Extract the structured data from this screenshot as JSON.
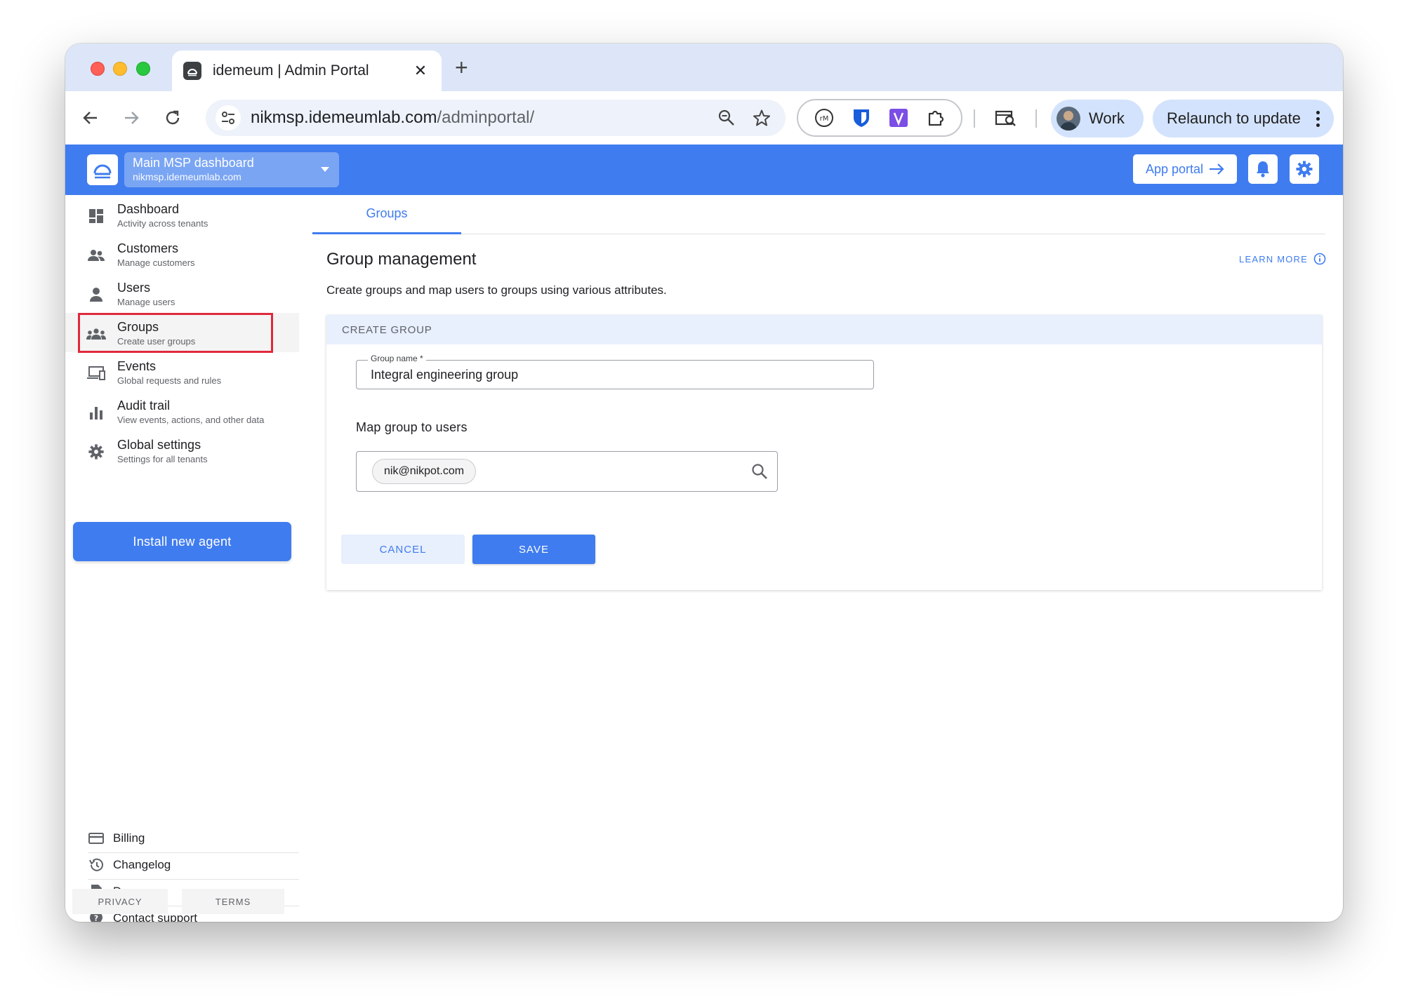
{
  "browser": {
    "tab_title": "idemeum | Admin Portal",
    "tab_close": "✕",
    "new_tab": "+",
    "url_host": "nikmsp.idemeumlab.com",
    "url_path": "/adminportal/",
    "profile_label": "Work",
    "relaunch_label": "Relaunch to update",
    "icons": [
      "back-icon",
      "forward-icon",
      "reload-icon",
      "tune-icon",
      "zoom-icon",
      "star-icon",
      "mymind-extension-icon",
      "bitwarden-extension-icon",
      "v-extension-icon",
      "extensions-puzzle-icon",
      "tab-search-icon"
    ]
  },
  "header": {
    "tenant_name": "Main MSP dashboard",
    "tenant_domain": "nikmsp.idemeumlab.com",
    "app_portal_label": "App portal",
    "brand_color": "#3f7cef"
  },
  "sidebar": {
    "items": [
      {
        "title": "Dashboard",
        "subtitle": "Activity across tenants",
        "icon": "dashboard-icon"
      },
      {
        "title": "Customers",
        "subtitle": "Manage customers",
        "icon": "customers-icon"
      },
      {
        "title": "Users",
        "subtitle": "Manage users",
        "icon": "user-icon"
      },
      {
        "title": "Groups",
        "subtitle": "Create user groups",
        "icon": "groups-icon",
        "active": true
      },
      {
        "title": "Events",
        "subtitle": "Global requests and rules",
        "icon": "devices-icon"
      },
      {
        "title": "Audit trail",
        "subtitle": "View events, actions, and other data",
        "icon": "bar-chart-icon"
      },
      {
        "title": "Global settings",
        "subtitle": "Settings for all tenants",
        "icon": "gear-icon"
      }
    ],
    "install_label": "Install new agent",
    "footer_links": [
      {
        "label": "Billing",
        "icon": "credit-card-icon"
      },
      {
        "label": "Changelog",
        "icon": "history-icon"
      },
      {
        "label": "Docs",
        "icon": "document-icon"
      },
      {
        "label": "Contact support",
        "icon": "help-icon"
      }
    ],
    "privacy_label": "PRIVACY",
    "terms_label": "TERMS"
  },
  "main": {
    "tab_label": "Groups",
    "title": "Group management",
    "learn_more": "LEARN MORE",
    "description": "Create groups and map users to groups using various attributes.",
    "card_heading": "CREATE GROUP",
    "group_name_label": "Group name *",
    "group_name_value": "Integral engineering group",
    "map_label": "Map group to users",
    "mapped_user_chip": "nik@nikpot.com",
    "cancel_label": "CANCEL",
    "save_label": "SAVE"
  }
}
